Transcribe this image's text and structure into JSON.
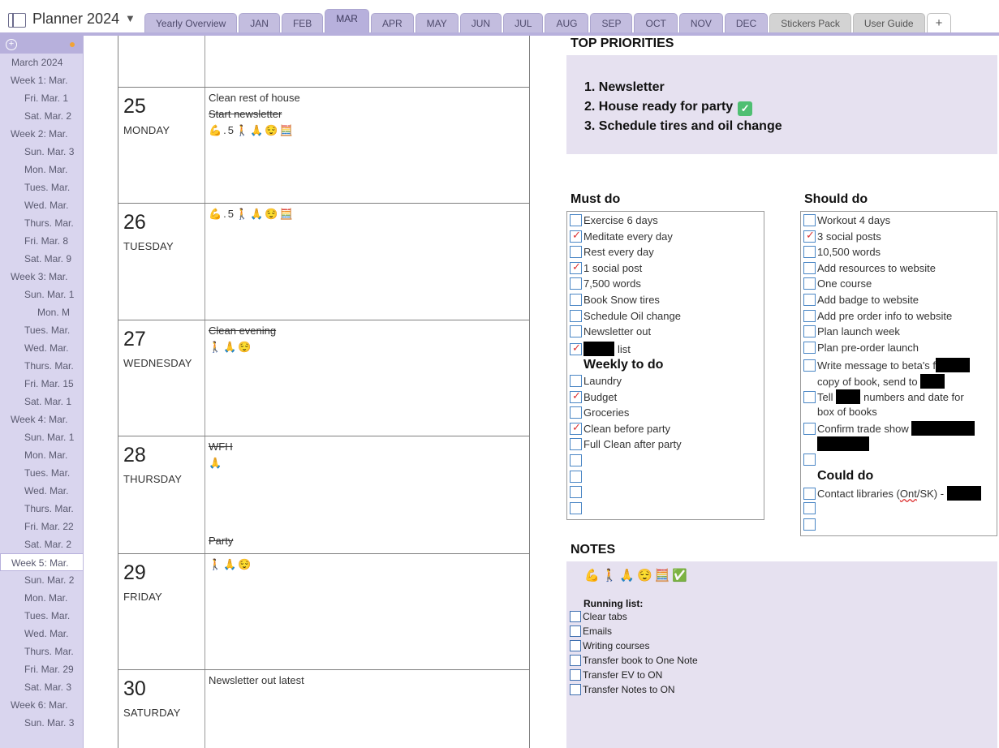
{
  "app": {
    "notebook_title": "Planner 2024",
    "tabs": [
      "Yearly Overview",
      "JAN",
      "FEB",
      "MAR",
      "APR",
      "MAY",
      "JUN",
      "JUL",
      "AUG",
      "SEP",
      "OCT",
      "NOV",
      "DEC",
      "Stickers Pack",
      "User Guide"
    ],
    "active_tab": "MAR",
    "add_tab_label": "+"
  },
  "sidebar": {
    "pages": [
      {
        "label": "March 2024",
        "level": 0
      },
      {
        "label": "Week 1: Mar.",
        "level": 1
      },
      {
        "label": "Fri. Mar. 1",
        "level": 2
      },
      {
        "label": "Sat. Mar. 2",
        "level": 2
      },
      {
        "label": "Week 2: Mar.",
        "level": 1
      },
      {
        "label": "Sun. Mar. 3",
        "level": 2
      },
      {
        "label": "Mon. Mar.",
        "level": 2
      },
      {
        "label": "Tues. Mar.",
        "level": 2
      },
      {
        "label": "Wed. Mar.",
        "level": 2
      },
      {
        "label": "Thurs. Mar.",
        "level": 2
      },
      {
        "label": "Fri. Mar. 8",
        "level": 2
      },
      {
        "label": "Sat. Mar. 9",
        "level": 2
      },
      {
        "label": "Week 3: Mar.",
        "level": 1
      },
      {
        "label": "Sun. Mar. 1",
        "level": 2
      },
      {
        "label": "Mon. M",
        "level": 3
      },
      {
        "label": "Tues. Mar.",
        "level": 2
      },
      {
        "label": "Wed. Mar.",
        "level": 2
      },
      {
        "label": "Thurs. Mar.",
        "level": 2
      },
      {
        "label": "Fri. Mar. 15",
        "level": 2
      },
      {
        "label": "Sat. Mar. 1",
        "level": 2
      },
      {
        "label": "Week 4: Mar.",
        "level": 1
      },
      {
        "label": "Sun. Mar. 1",
        "level": 2
      },
      {
        "label": "Mon. Mar.",
        "level": 2
      },
      {
        "label": "Tues. Mar.",
        "level": 2
      },
      {
        "label": "Wed. Mar.",
        "level": 2
      },
      {
        "label": "Thurs. Mar.",
        "level": 2
      },
      {
        "label": "Fri. Mar. 22",
        "level": 2
      },
      {
        "label": "Sat. Mar. 2",
        "level": 2
      },
      {
        "label": "Week 5: Mar.",
        "level": 1,
        "selected": true
      },
      {
        "label": "Sun. Mar. 2",
        "level": 2
      },
      {
        "label": "Mon. Mar.",
        "level": 2
      },
      {
        "label": "Tues. Mar.",
        "level": 2
      },
      {
        "label": "Wed. Mar.",
        "level": 2
      },
      {
        "label": "Thurs. Mar.",
        "level": 2
      },
      {
        "label": "Fri. Mar. 29",
        "level": 2
      },
      {
        "label": "Sat. Mar. 3",
        "level": 2
      },
      {
        "label": "Week 6: Mar.",
        "level": 1
      },
      {
        "label": "Sun. Mar. 3",
        "level": 2
      }
    ]
  },
  "days": [
    {
      "num": "25",
      "name": "MONDAY",
      "notes": [
        {
          "text": "Clean rest of house",
          "strike": false
        },
        {
          "text": "Start newsletter",
          "strike": true
        },
        {
          "text": "💪.5🚶🙏😌🧮",
          "strike": false,
          "emoji": true
        }
      ]
    },
    {
      "num": "26",
      "name": "TUESDAY",
      "notes": [
        {
          "text": "💪.5🚶🙏😌🧮",
          "strike": false,
          "emoji": true
        }
      ]
    },
    {
      "num": "27",
      "name": "WEDNESDAY",
      "notes": [
        {
          "text": "Clean evening",
          "strike": true
        },
        {
          "text": "🚶🙏😌",
          "strike": false,
          "emoji": true
        }
      ]
    },
    {
      "num": "28",
      "name": "THURSDAY",
      "notes": [
        {
          "text": "WFH",
          "strike": true
        },
        {
          "text": "🙏",
          "strike": false,
          "emoji": true
        }
      ],
      "bottom_note": "Party"
    },
    {
      "num": "29",
      "name": "FRIDAY",
      "notes": [
        {
          "text": "🚶🙏😌",
          "strike": false,
          "emoji": true
        }
      ]
    },
    {
      "num": "30",
      "name": "SATURDAY",
      "notes": [
        {
          "text": "Newsletter out latest",
          "strike": false
        }
      ]
    }
  ],
  "priorities": {
    "heading": "TOP PRIORITIES",
    "items": [
      "1. Newsletter",
      "2. House ready for party",
      "3. Schedule tires and oil change"
    ],
    "done_mark": "✓"
  },
  "must_do": {
    "heading": "Must do",
    "items": [
      {
        "text": "Exercise 6 days",
        "checked": false
      },
      {
        "text": "Meditate every day",
        "checked": true
      },
      {
        "text": "Rest every day",
        "checked": false
      },
      {
        "text": "1 social post",
        "checked": true
      },
      {
        "text": "7,500 words",
        "checked": false
      },
      {
        "text": "Book Snow tires",
        "checked": false
      },
      {
        "text": "Schedule Oil change",
        "checked": false
      },
      {
        "text": "Newsletter out",
        "checked": false
      },
      {
        "text": "list",
        "checked": true,
        "redact_before": 38
      }
    ],
    "weekly_heading": "Weekly to do",
    "weekly": [
      {
        "text": "Laundry",
        "checked": false
      },
      {
        "text": "Budget",
        "checked": true
      },
      {
        "text": "Groceries",
        "checked": false
      },
      {
        "text": "Clean before party",
        "checked": true
      },
      {
        "text": "Full Clean after party",
        "checked": false
      }
    ]
  },
  "should_do": {
    "heading": "Should do",
    "items": [
      {
        "text": "Workout 4 days",
        "checked": false
      },
      {
        "text": "3 social posts",
        "checked": true
      },
      {
        "text": "10,500 words",
        "checked": false
      },
      {
        "text": "Add resources to website",
        "checked": false
      },
      {
        "text": "One course",
        "checked": false
      },
      {
        "text": "Add badge to website",
        "checked": false
      },
      {
        "text": "Add pre order info to website",
        "checked": false
      },
      {
        "text": "Plan launch week",
        "checked": false
      },
      {
        "text": "Plan pre-order launch",
        "checked": false
      }
    ],
    "multi": {
      "beta_line1": "Write message to beta's f",
      "beta_line2": "copy of book, send to",
      "tell_a": "Tell",
      "tell_b": "numbers and date for",
      "tell_line2": "box of books",
      "confirm": "Confirm trade show"
    },
    "could_heading": "Could do",
    "contact_a": "Contact libraries (",
    "contact_ont": "Ont",
    "contact_b": "/SK) -"
  },
  "notes": {
    "heading": "NOTES",
    "emoji_row": "💪🚶🙏😌🧮✅",
    "running_label": "Running list:",
    "items": [
      "Clear tabs",
      "Emails",
      "Writing courses",
      "Transfer book to One Note",
      "Transfer EV to ON",
      "Transfer Notes to ON"
    ]
  }
}
